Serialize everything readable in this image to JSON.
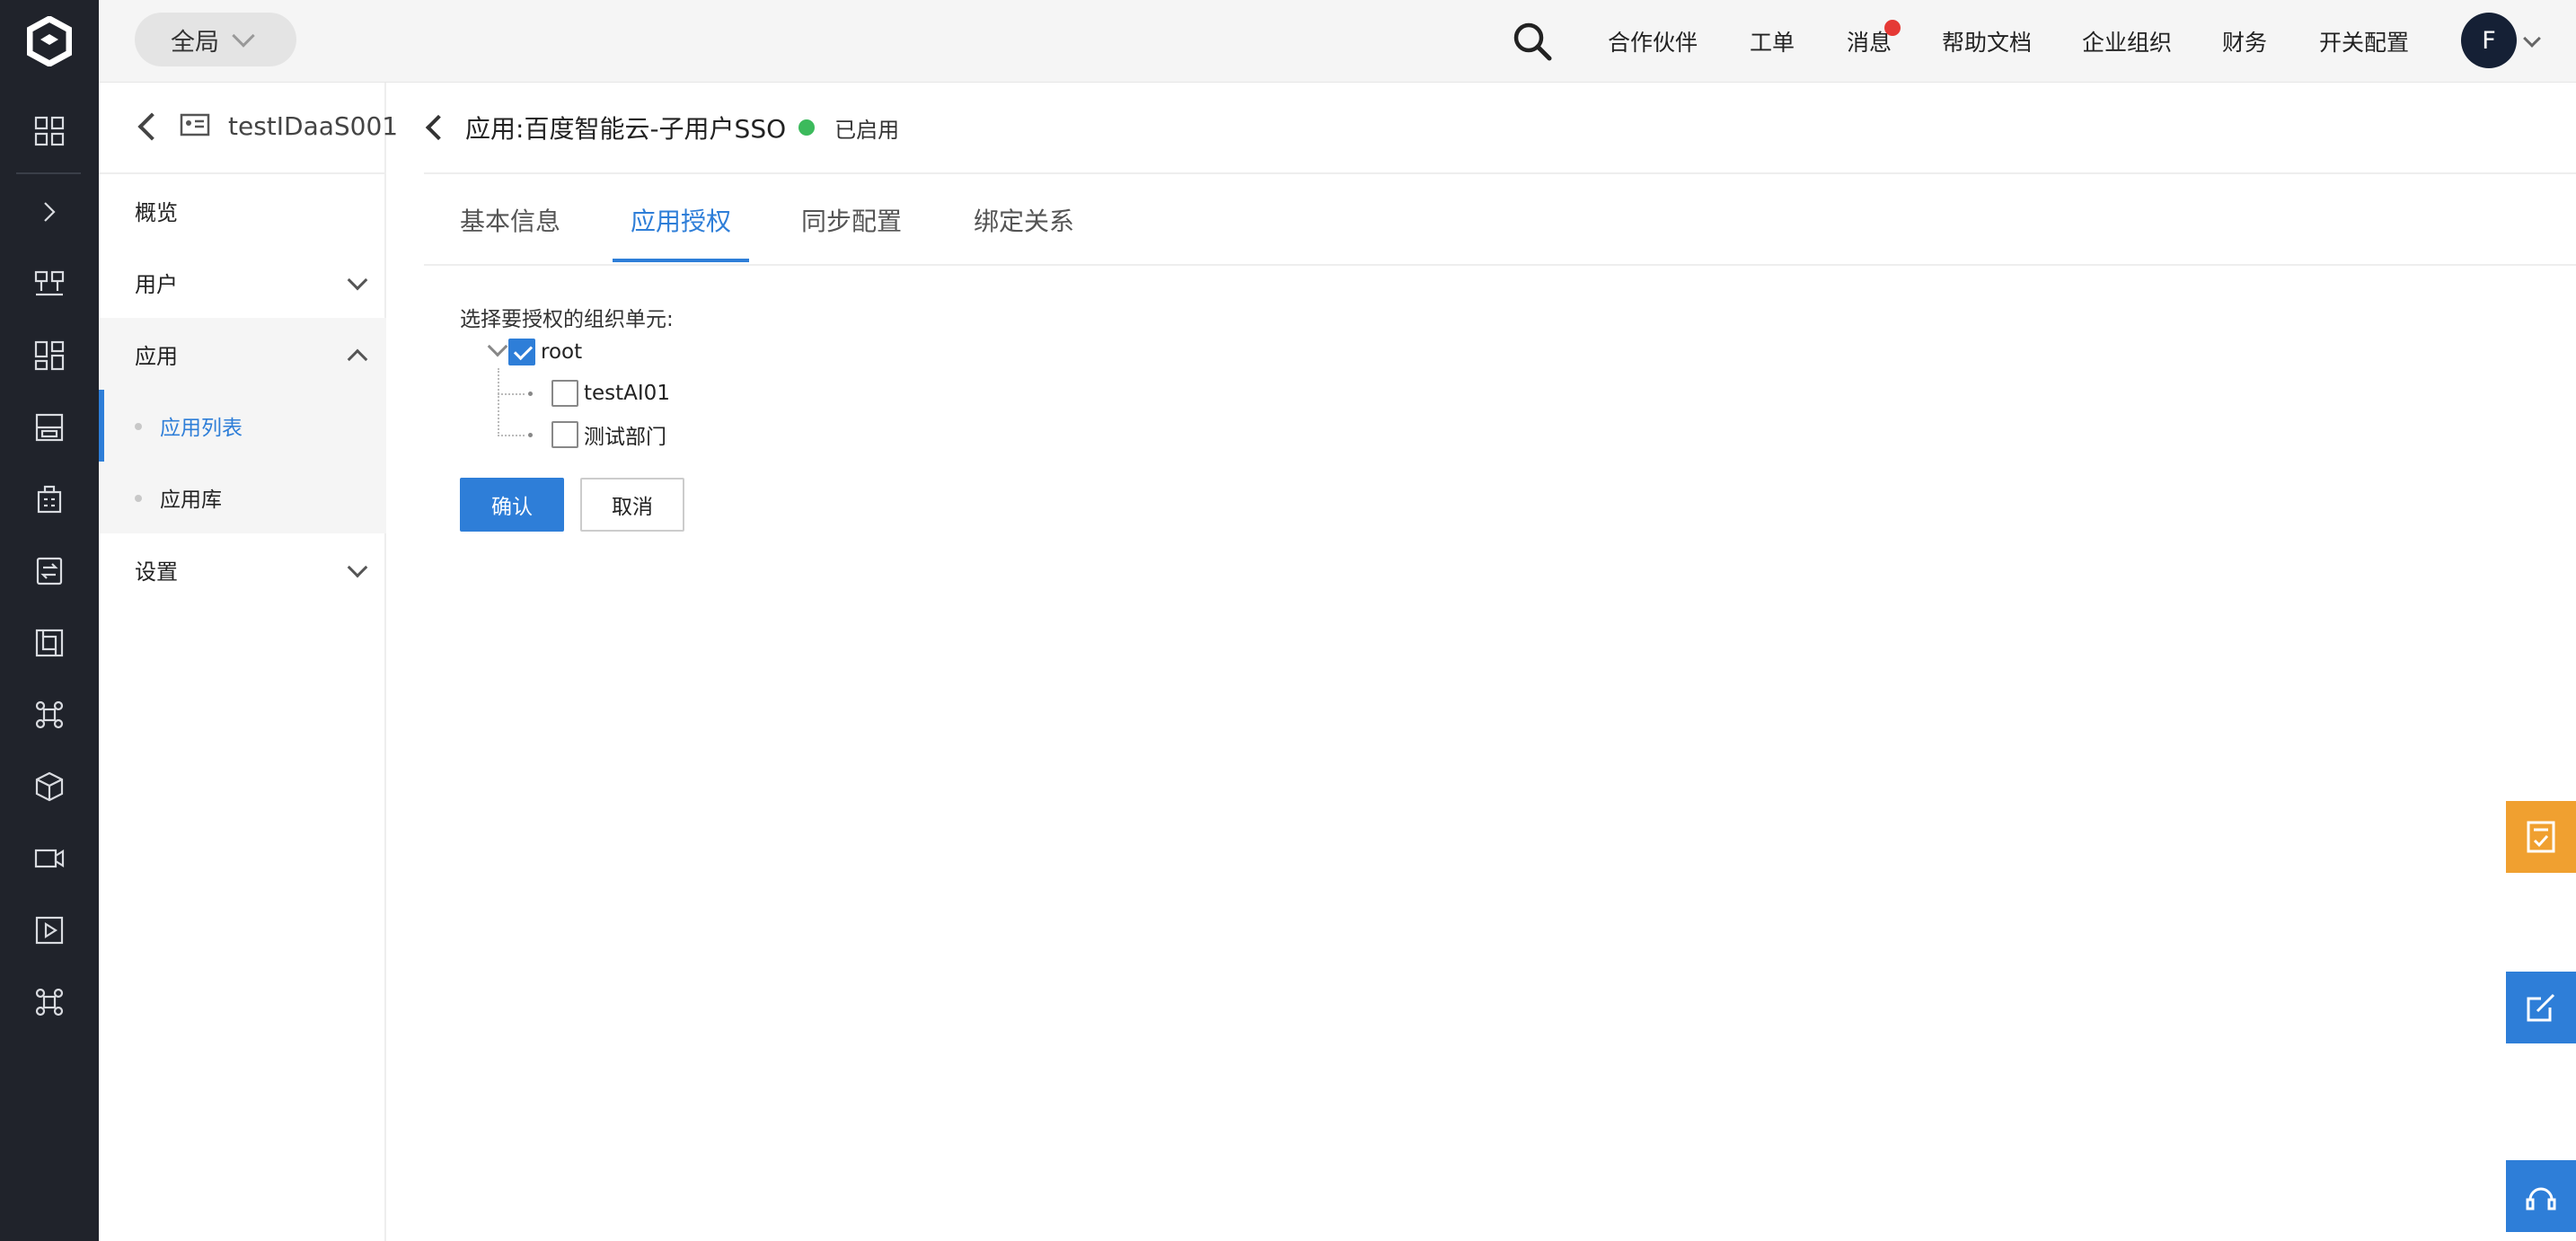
{
  "topbar": {
    "region": "全局",
    "nav": [
      "合作伙伴",
      "工单",
      "消息",
      "帮助文档",
      "企业组织",
      "财务",
      "开关配置"
    ],
    "avatar_letter": "F"
  },
  "sidebar": {
    "title": "testIDaaS001",
    "items": {
      "overview": "概览",
      "users": "用户",
      "apps": "应用",
      "app_list": "应用列表",
      "app_store": "应用库",
      "settings": "设置"
    }
  },
  "main": {
    "crumb_prefix": "应用:",
    "app_name": "百度智能云-子用户SSO",
    "status": "已启用",
    "tabs": [
      "基本信息",
      "应用授权",
      "同步配置",
      "绑定关系"
    ],
    "active_tab": "应用授权",
    "section_label": "选择要授权的组织单元:",
    "tree": {
      "root": "root",
      "children": [
        "testAI01",
        "测试部门"
      ]
    },
    "confirm": "确认",
    "cancel": "取消"
  },
  "colors": {
    "accent": "#2e7ed8",
    "status_green": "#3cba5c",
    "badge_red": "#e53935",
    "float_orange": "#f0a030",
    "float_blue": "#2e7ed8"
  }
}
